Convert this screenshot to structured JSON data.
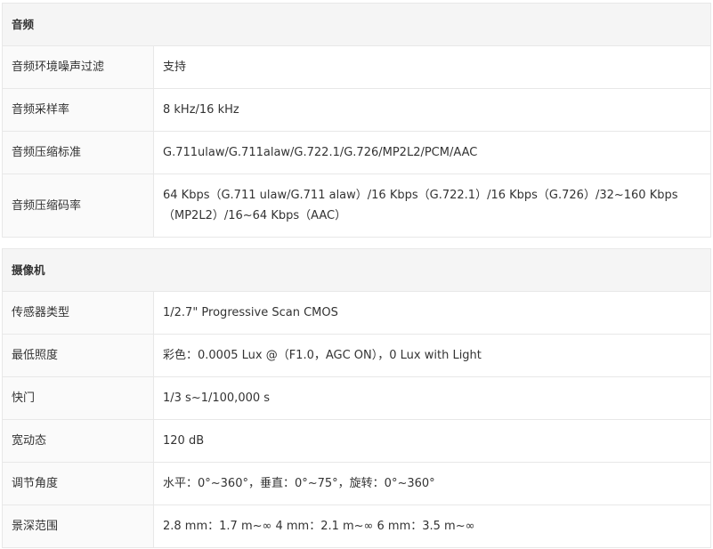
{
  "sections": [
    {
      "title": "音频",
      "rows": [
        {
          "label": "音频环境噪声过滤",
          "value": "支持"
        },
        {
          "label": "音频采样率",
          "value": "8 kHz/16 kHz"
        },
        {
          "label": "音频压缩标准",
          "value": "G.711ulaw/G.711alaw/G.722.1/G.726/MP2L2/PCM/AAC"
        },
        {
          "label": "音频压缩码率",
          "value": "64 Kbps（G.711 ulaw/G.711 alaw）/16 Kbps（G.722.1）/16 Kbps（G.726）/32~160 Kbps（MP2L2）/16~64 Kbps（AAC）"
        }
      ]
    },
    {
      "title": "摄像机",
      "rows": [
        {
          "label": "传感器类型",
          "value": "1/2.7\" Progressive Scan CMOS"
        },
        {
          "label": "最低照度",
          "value": "彩色：0.0005 Lux @（F1.0，AGC ON），0 Lux with Light"
        },
        {
          "label": "快门",
          "value": "1/3 s~1/100,000 s"
        },
        {
          "label": "宽动态",
          "value": "120 dB"
        },
        {
          "label": "调节角度",
          "value": "水平：0°~360°，垂直：0°~75°，旋转：0°~360°"
        },
        {
          "label": "景深范围",
          "value": "2.8 mm：1.7 m~∞ 4 mm：2.1 m~∞ 6 mm：3.5 m~∞"
        }
      ]
    }
  ]
}
